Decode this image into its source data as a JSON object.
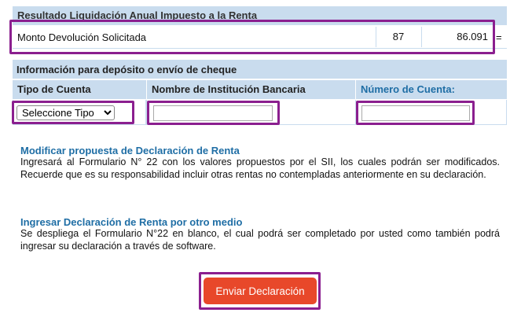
{
  "resultado": {
    "title": "Resultado Liquidación Anual Impuesto a la Renta",
    "row_label": "Monto Devolución Solicitada",
    "code": "87",
    "amount": "86.091",
    "suffix": "="
  },
  "deposito": {
    "title": "Información para depósito o envío de cheque",
    "col_tipo": "Tipo de Cuenta",
    "col_banco": "Nombre de Institución Bancaria",
    "col_numero": "Número de Cuenta:",
    "tipo_selected": "Seleccione Tipo",
    "banco_value": "",
    "numero_value": ""
  },
  "modificar": {
    "title": "Modificar propuesta de Declaración de Renta",
    "text": "Ingresará al Formulario N° 22 con los valores propuestos por el SII, los cuales podrán ser modificados. Recuerde que es su responsabilidad incluir otras rentas no contempladas anteriormente en su declaración."
  },
  "otro_medio": {
    "title": "Ingresar Declaración de Renta por otro medio",
    "text": "Se despliega el Formulario N°22 en blanco, el cual podrá ser completado por usted como también podrá ingresar su declaración a través de software."
  },
  "submit_label": "Enviar Declaración",
  "colors": {
    "header_bg": "#c9dcee",
    "highlight_border": "#8b1f8f",
    "link_blue": "#1f6ea5",
    "button_red": "#e8482a"
  }
}
